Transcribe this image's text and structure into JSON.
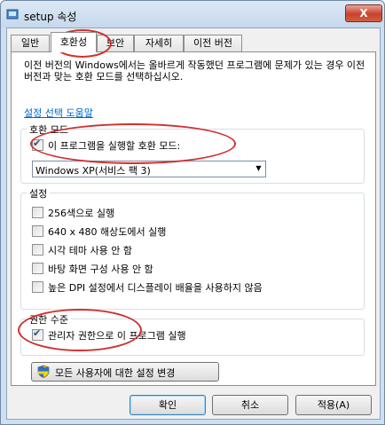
{
  "window": {
    "title": "setup 속성",
    "close_label": "X"
  },
  "tabs": [
    {
      "label": "일반"
    },
    {
      "label": "호환성",
      "active": true
    },
    {
      "label": "보안"
    },
    {
      "label": "자세히"
    },
    {
      "label": "이전 버전"
    }
  ],
  "description": "이전 버전의 Windows에서는 올바르게 작동했던 프로그램에 문제가 있는 경우 이전 버전과 맞는 호환 모드를 선택하십시오.",
  "help_link": "설정 선택 도움말",
  "compat_mode": {
    "group_label": "호환 모드",
    "checkbox_label": "이 프로그램을 실행할 호환 모드:",
    "checked": true,
    "selected_os": "Windows XP(서비스 팩 3)"
  },
  "settings": {
    "group_label": "설정",
    "options": [
      {
        "label": "256색으로 실행",
        "checked": false
      },
      {
        "label": "640 x 480 해상도에서 실행",
        "checked": false
      },
      {
        "label": "시각 테마 사용 안 함",
        "checked": false
      },
      {
        "label": "바탕 화면 구성 사용 안 함",
        "checked": false
      },
      {
        "label": "높은 DPI 설정에서 디스플레이 배율을 사용하지 않음",
        "checked": false
      }
    ]
  },
  "privilege": {
    "group_label": "권한 수준",
    "checkbox_label": "관리자 권한으로 이 프로그램 실행",
    "checked": true
  },
  "all_users_button": "모든 사용자에 대한 설정 변경",
  "buttons": {
    "ok": "확인",
    "cancel": "취소",
    "apply": "적용(A)"
  },
  "annotation_color": "#d13030"
}
